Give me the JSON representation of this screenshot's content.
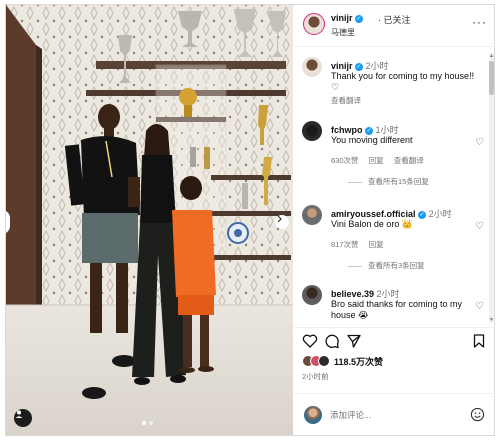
{
  "post": {
    "username": "vinijr",
    "follow_status": "· 已关注",
    "location": "马德里",
    "more_icon": "more-horizontal-icon",
    "likes": "118.5万次赞",
    "posted_time": "2小时前",
    "add_comment_placeholder": "添加评论...",
    "carousel_dots": 2,
    "active_dot": 0
  },
  "comments": [
    {
      "user": "vinijr",
      "time": "2小时",
      "text": "Thank you for coming to my house!! ♡",
      "meta": [
        "查看翻译"
      ],
      "replies": ""
    },
    {
      "user": "fchwpo",
      "time": "1小时",
      "text": "You moving different",
      "meta": [
        "630次赞",
        "回复",
        "查看翻译"
      ],
      "replies": "查看所有15条回复"
    },
    {
      "user": "amiryoussef.official",
      "time": "2小时",
      "text": "Vini Balon de oro 👑",
      "meta": [
        "817次赞",
        "回复"
      ],
      "replies": "查看所有3条回复"
    },
    {
      "user": "believe.39",
      "time": "2小时",
      "text": "Bro said thanks for coming to my house 😭",
      "meta": [],
      "replies": ""
    }
  ],
  "colors": {
    "verified": "#1d9bf0",
    "muted_text": "#737373",
    "divider": "#efefef",
    "wallpaper": "#ece8e1"
  },
  "icons": [
    "heart-icon",
    "comment-icon",
    "share-icon",
    "bookmark-icon",
    "emoji-icon",
    "verified-badge-icon"
  ]
}
